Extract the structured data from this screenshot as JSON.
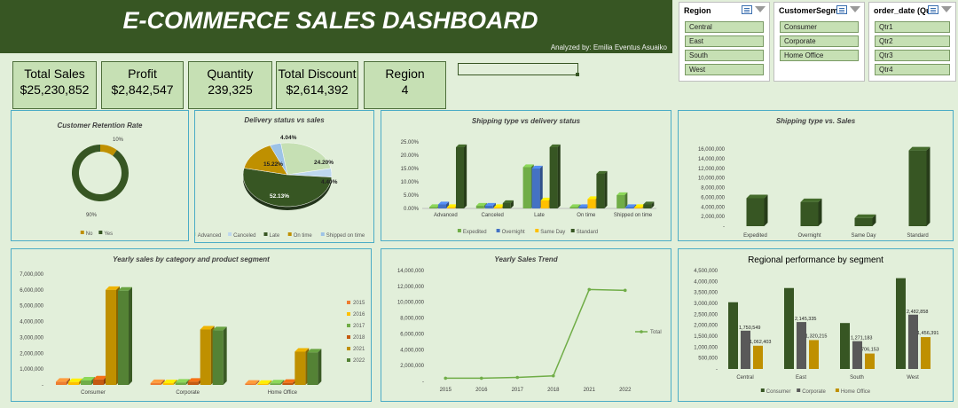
{
  "header": {
    "title": "E-COMMERCE SALES DASHBOARD",
    "subtitle": "Analyzed by: Emilia Eventus Asuaiko"
  },
  "kpis": [
    {
      "label": "Total Sales",
      "value": "$25,230,852"
    },
    {
      "label": "Profit",
      "value": "$2,842,547"
    },
    {
      "label": "Quantity",
      "value": "239,325"
    },
    {
      "label": "Total Discount",
      "value": "$2,614,392"
    },
    {
      "label": "Region",
      "value": "4"
    }
  ],
  "slicers": [
    {
      "title": "Region",
      "items": [
        "Central",
        "East",
        "South",
        "West"
      ]
    },
    {
      "title": "CustomerSegm...",
      "items": [
        "Consumer",
        "Corporate",
        "Home Office"
      ]
    },
    {
      "title": "order_date (Qu...",
      "items": [
        "Qtr1",
        "Qtr2",
        "Qtr3",
        "Qtr4"
      ]
    }
  ],
  "colors": {
    "banner": "#375623",
    "background": "#e2efda",
    "panel_border": "#4bacc6",
    "dark_green": "#375623",
    "gold": "#bf9000",
    "blue": "#4472c4",
    "light_green": "#70ad47",
    "yellow": "#ffc000",
    "gray": "#595959"
  },
  "chart_data": [
    {
      "type": "pie",
      "variant": "donut",
      "title": "Customer Retention Rate",
      "labels": [
        "No",
        "Yes"
      ],
      "values": [
        10,
        90
      ],
      "data_labels": [
        "10%",
        "90%"
      ],
      "colors": [
        "#bf9000",
        "#375623"
      ],
      "legend": "bottom"
    },
    {
      "type": "pie",
      "title": "Delivery status vs sales",
      "labels": [
        "Advanced",
        "Canceled",
        "Late",
        "On time",
        "Shipped on time"
      ],
      "values": [
        24.2,
        4.4,
        52.13,
        15.22,
        4.04
      ],
      "data_labels": [
        "24.20%",
        "4.40%",
        "52.13%",
        "15.22%",
        "4.04%"
      ],
      "colors": [
        "#c6e0b4",
        "#bdd7ee",
        "#375623",
        "#bf9000",
        "#9dc3e6"
      ],
      "legend": "bottom"
    },
    {
      "type": "bar",
      "title": "Shipping type vs delivery status",
      "categories": [
        "Advanced",
        "Canceled",
        "Late",
        "On time",
        "Shipped on time"
      ],
      "series": [
        {
          "name": "Expedited",
          "values": [
            0.5,
            1.0,
            15.5,
            0.5,
            5.0
          ]
        },
        {
          "name": "Overnight",
          "values": [
            1.5,
            1.0,
            15.0,
            0.5,
            0.5
          ]
        },
        {
          "name": "Same Day",
          "values": [
            0.5,
            0.5,
            3.0,
            3.5,
            0.5
          ]
        },
        {
          "name": "Standard",
          "values": [
            23.0,
            2.0,
            23.0,
            13.0,
            1.5
          ]
        }
      ],
      "colors": [
        "#70ad47",
        "#4472c4",
        "#ffc000",
        "#375623"
      ],
      "yticks": [
        "0.00%",
        "5.00%",
        "10.00%",
        "15.00%",
        "20.00%",
        "25.00%"
      ],
      "ylim": [
        0,
        25
      ],
      "legend": "bottom"
    },
    {
      "type": "bar",
      "title": "Shipping type vs. Sales",
      "categories": [
        "Expedited",
        "Overnight",
        "Same Day",
        "Standard"
      ],
      "values": [
        5800000,
        5000000,
        1700000,
        15700000
      ],
      "colors": [
        "#375623"
      ],
      "yticks": [
        "-",
        "2,000,000",
        "4,000,000",
        "6,000,000",
        "8,000,000",
        "10,000,000",
        "12,000,000",
        "14,000,000",
        "16,000,000"
      ],
      "ylim": [
        0,
        16000000
      ]
    },
    {
      "type": "bar",
      "title": "Yearly sales by category and product segment",
      "categories": [
        "Consumer",
        "Corporate",
        "Home Office"
      ],
      "series": [
        {
          "name": "2015",
          "values": [
            200000,
            120000,
            80000
          ]
        },
        {
          "name": "2016",
          "values": [
            180000,
            110000,
            70000
          ]
        },
        {
          "name": "2017",
          "values": [
            280000,
            150000,
            100000
          ]
        },
        {
          "name": "2018",
          "values": [
            350000,
            200000,
            130000
          ]
        },
        {
          "name": "2021",
          "values": [
            6000000,
            3500000,
            2100000
          ]
        },
        {
          "name": "2022",
          "values": [
            5950000,
            3450000,
            2050000
          ]
        }
      ],
      "colors": [
        "#ed7d31",
        "#ffc000",
        "#70ad47",
        "#c55a11",
        "#bf9000",
        "#548235"
      ],
      "yticks": [
        "-",
        "1,000,000",
        "2,000,000",
        "3,000,000",
        "4,000,000",
        "5,000,000",
        "6,000,000",
        "7,000,000"
      ],
      "ylim": [
        0,
        7000000
      ],
      "legend": "right"
    },
    {
      "type": "line",
      "title": "Yearly Sales Trend",
      "x": [
        "2015",
        "2016",
        "2017",
        "2018",
        "2021",
        "2022"
      ],
      "series": [
        {
          "name": "Total",
          "values": [
            400000,
            400000,
            500000,
            700000,
            11600000,
            11500000
          ]
        }
      ],
      "colors": [
        "#70ad47"
      ],
      "yticks": [
        "-",
        "2,000,000",
        "4,000,000",
        "6,000,000",
        "8,000,000",
        "10,000,000",
        "12,000,000",
        "14,000,000"
      ],
      "ylim": [
        0,
        14000000
      ],
      "legend": "right"
    },
    {
      "type": "bar",
      "title": "Regional performance by segment",
      "categories": [
        "Central",
        "East",
        "South",
        "West"
      ],
      "series": [
        {
          "name": "Consumer",
          "values": [
            3050000,
            3700000,
            2100000,
            4150000
          ],
          "labels": [
            "",
            "",
            "",
            ""
          ]
        },
        {
          "name": "Corporate",
          "values": [
            1750549,
            2145335,
            1271183,
            2482858
          ],
          "labels": [
            "1,750,549",
            "2,145,335",
            "1,271,183",
            "2,482,858"
          ]
        },
        {
          "name": "Home Office",
          "values": [
            1062403,
            1320215,
            706153,
            1456391
          ],
          "labels": [
            "1,062,403",
            "1,320,215",
            "706,153",
            "1,456,391"
          ]
        }
      ],
      "colors": [
        "#375623",
        "#595959",
        "#bf9000"
      ],
      "yticks": [
        "-",
        "500,000",
        "1,000,000",
        "1,500,000",
        "2,000,000",
        "2,500,000",
        "3,000,000",
        "3,500,000",
        "4,000,000",
        "4,500,000"
      ],
      "ylim": [
        0,
        4500000
      ],
      "legend": "bottom"
    }
  ]
}
